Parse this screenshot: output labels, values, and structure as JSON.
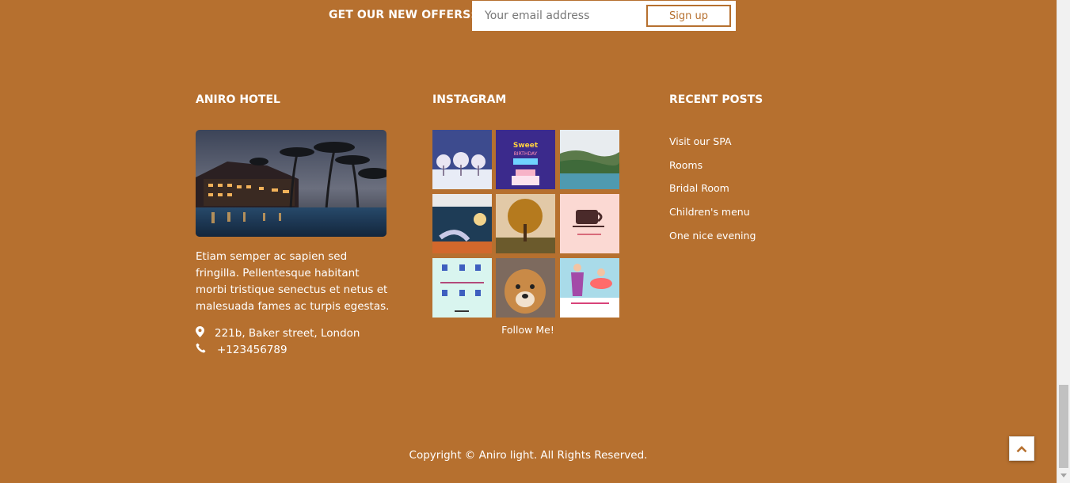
{
  "newsletter": {
    "label": "GET OUR NEW OFFERS:",
    "placeholder": "Your email address",
    "button": "Sign up"
  },
  "about": {
    "title": "ANIRO HOTEL",
    "image": "hotel-resort-at-dusk-photo",
    "text": "Etiam semper ac sapien sed fringilla. Pellentesque habitant morbi tristique senectus et netus et malesuada fames ac turpis egestas.",
    "address": "221b, Baker street, London",
    "phone": "+123456789",
    "icons": {
      "address": "map-marker-icon",
      "phone": "phone-icon"
    }
  },
  "instagram": {
    "title": "INSTAGRAM",
    "tiles": [
      "snowy-trees-night-photo",
      "sweet-birthday-graphic",
      "lake-landscape-photo",
      "moon-dancer-illustration",
      "autumn-tree-photo",
      "coffee-cup-graphic",
      "people-types-infographic",
      "dog-photo",
      "office-people-illustration"
    ],
    "follow": "Follow Me!"
  },
  "recent_posts": {
    "title": "RECENT POSTS",
    "items": [
      "Visit our SPA",
      "Rooms",
      "Bridal Room",
      "Children's menu",
      "One nice evening"
    ]
  },
  "copyright": "Copyright ©  Aniro light. All Rights Reserved.",
  "back_to_top": "chevron-up-icon",
  "colors": {
    "background": "#b6702f",
    "accent": "#b6702f",
    "text": "#ffffff"
  }
}
